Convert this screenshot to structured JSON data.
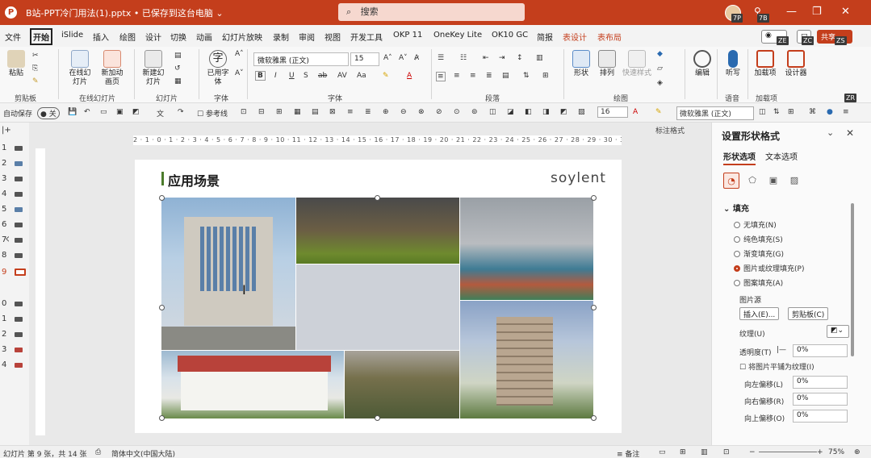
{
  "titlebar": {
    "doc_title": "B站-PPT冷门用法(1).pptx • 已保存到这台电脑 ⌄",
    "search_placeholder": "搜索",
    "badges": [
      "7P",
      "7B"
    ],
    "icons": [
      "powerpoint-icon",
      "search-icon",
      "minimize-icon",
      "restore-icon",
      "close-icon"
    ]
  },
  "menu": {
    "tabs": [
      "文件",
      "开始",
      "iSlide",
      "插入",
      "绘图",
      "设计",
      "切换",
      "动画",
      "幻灯片放映",
      "录制",
      "审阅",
      "视图",
      "开发工具",
      "OKP 11",
      "OneKey Lite",
      "OK10 GC",
      "简报",
      "表设计",
      "表布局"
    ],
    "active_tab": "开始",
    "right_badges": [
      "ZE",
      "ZC",
      "ZS"
    ],
    "share_label": "共享"
  },
  "ribbon": {
    "clipboard": {
      "paste": "粘贴",
      "label": "剪贴板"
    },
    "online_slide": {
      "online": "在线幻灯片",
      "new_anim": "新加动画页",
      "label": "在线幻灯片"
    },
    "slides": {
      "new_slide": "新建幻灯片",
      "label": "幻灯片"
    },
    "font_tool": {
      "used_font": "已用字体",
      "label": "字体"
    },
    "font": {
      "name": "微软雅黑 (正文)",
      "size": "15",
      "label": "字体"
    },
    "paragraph": {
      "label": "段落"
    },
    "drawing": {
      "shape": "形状",
      "arrange": "排列",
      "quick_style": "快速样式",
      "label": "绘图"
    },
    "editing": {
      "edit": "编辑"
    },
    "voice": {
      "dictate": "听写",
      "label": "语音"
    },
    "addins": {
      "addins": "加载项",
      "designer": "设计器",
      "label": "加载项"
    },
    "zr_badge": "ZR"
  },
  "qat": {
    "autosave": "自动保存",
    "autosave_state": "关",
    "gridlines": "参考线",
    "font_size": "16",
    "font_name": "微软雅黑 (正文)",
    "mark_format": "标注格式"
  },
  "thumbs": {
    "numbers": [
      "1",
      "2",
      "3",
      "4",
      "5",
      "6",
      "7",
      "8",
      "9",
      "0",
      "1",
      "2",
      "3",
      "4"
    ],
    "current_index": 8
  },
  "ruler": {
    "h": "2 · 1 · 0 · 1 · 2 · 3 · 4 · 5 · 6 · 7 · 8 · 9 · 10 · 11 · 12 · 13 · 14 · 15 · 16 · 17 · 18 · 19 · 20 · 21 · 22 · 23 · 24 · 25 · 26 · 27 · 28 · 29 · 30 · 31",
    "v_marks": [
      "2",
      "1",
      "1",
      "2",
      "3",
      "4",
      "5",
      "6",
      "7",
      "8",
      "9",
      "10",
      "11",
      "12",
      "13",
      "14",
      "15",
      "16"
    ]
  },
  "slide": {
    "title": "应用场景",
    "brand": "soylent"
  },
  "pane": {
    "title": "设置形状格式",
    "tabs": [
      "形状选项",
      "文本选项"
    ],
    "section": "填充",
    "fill_options": [
      "无填充(N)",
      "纯色填充(S)",
      "渐变填充(G)",
      "图片或纹理填充(P)",
      "图案填充(A)"
    ],
    "selected_fill": 3,
    "picture_source": "图片源",
    "insert_btn": "插入(E)...",
    "clipboard_btn": "剪贴板(C)",
    "texture": "纹理(U)",
    "transparency": "透明度(T)",
    "transparency_value": "0%",
    "tile": "将图片平铺为纹理(I)",
    "offsets": [
      {
        "label": "向左偏移(L)",
        "value": "0%"
      },
      {
        "label": "向右偏移(R)",
        "value": "0%"
      },
      {
        "label": "向上偏移(O)",
        "value": "0%"
      }
    ]
  },
  "status": {
    "slide_info": "幻灯片 第 9 张，共 14 张",
    "language": "简体中文(中国大陆)",
    "notes": "备注",
    "zoom": "75%"
  }
}
